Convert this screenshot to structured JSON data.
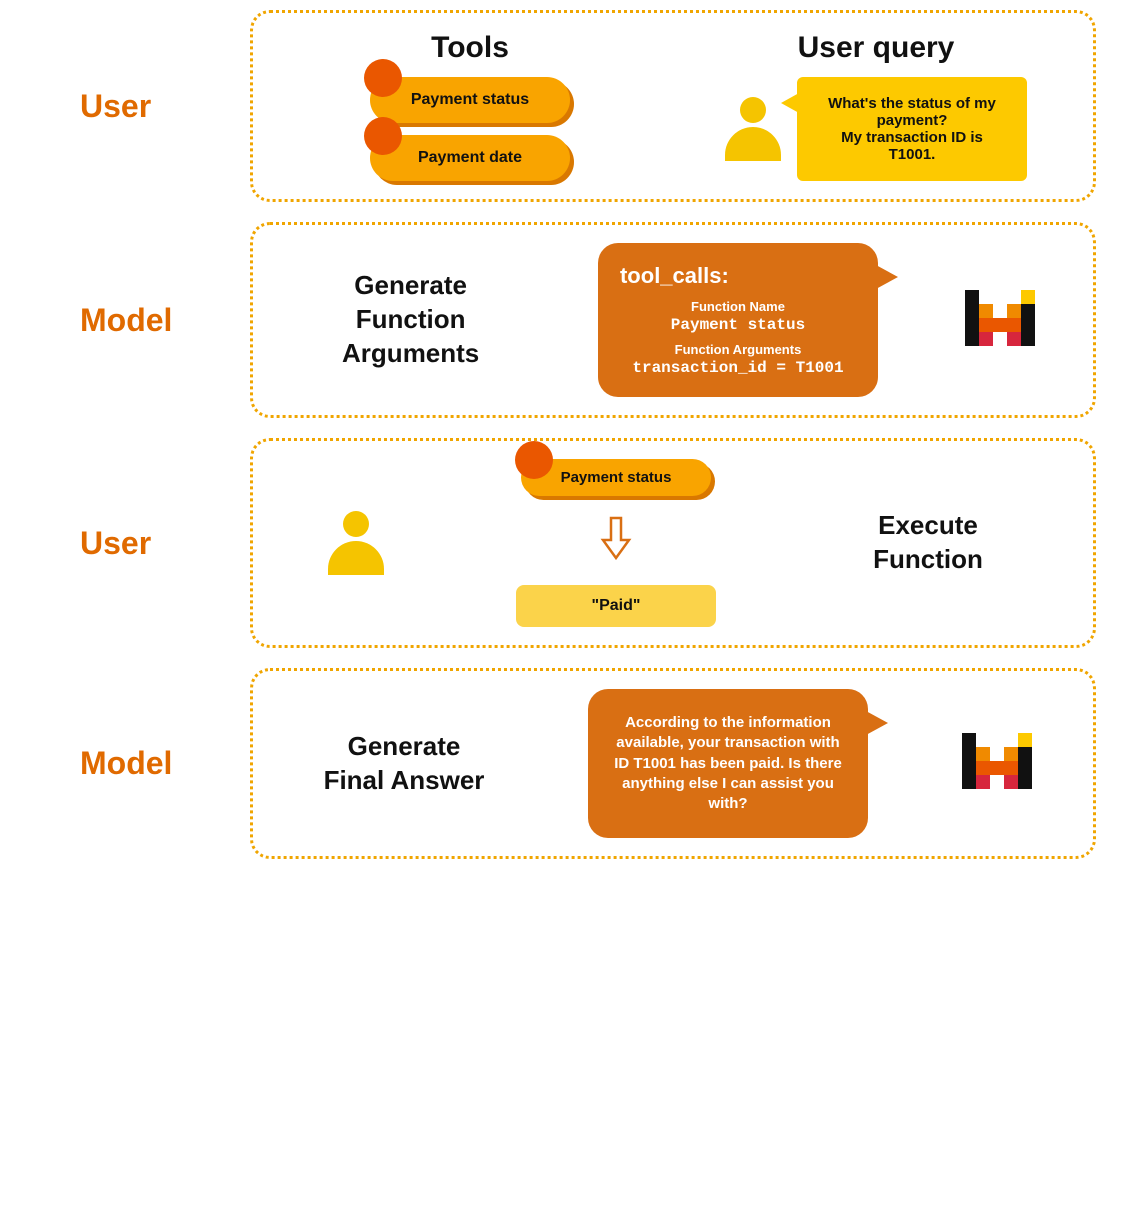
{
  "roles": {
    "user": "User",
    "model": "Model"
  },
  "panel1": {
    "tools_heading": "Tools",
    "query_heading": "User query",
    "tool1": "Payment status",
    "tool2": "Payment date",
    "query_text": "What's the status of my payment?\nMy transaction ID is T1001."
  },
  "panel2": {
    "heading": "Generate Function Arguments",
    "bubble_title": "tool_calls:",
    "fn_name_label": "Function Name",
    "fn_name": "Payment status",
    "fn_args_label": "Function Arguments",
    "fn_args": "transaction_id = T1001"
  },
  "panel3": {
    "tool": "Payment status",
    "result": "\"Paid\"",
    "heading": "Execute Function"
  },
  "panel4": {
    "heading": "Generate Final Answer",
    "answer": "According to the information available, your transaction with ID T1001 has been paid. Is there anything else I can assist you with?"
  }
}
